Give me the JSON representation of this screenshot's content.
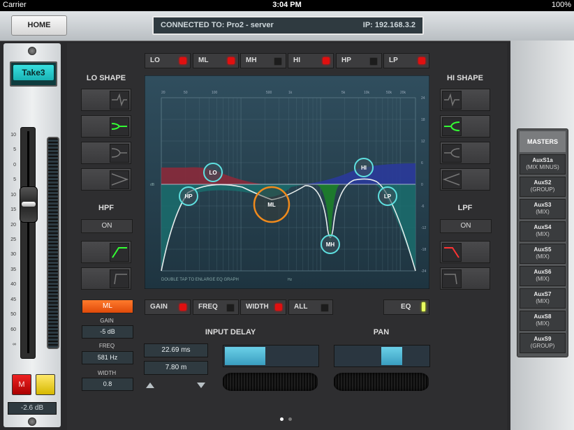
{
  "status_bar": {
    "carrier": "Carrier",
    "time": "3:04 PM",
    "battery": "100%"
  },
  "topbar": {
    "home_label": "HOME",
    "connected_label": "CONNECTED TO: Pro2 - server",
    "ip_label": "IP: 192.168.3.2"
  },
  "channel": {
    "name": "Take3",
    "mute_label": "M",
    "gain_readout": "-2.6 dB",
    "fader_scale": [
      "10",
      "5",
      "0",
      "5",
      "10",
      "15",
      "20",
      "25",
      "30",
      "35",
      "40",
      "45",
      "50",
      "60",
      "∞"
    ]
  },
  "eq_tabs": [
    {
      "label": "LO",
      "led": "on"
    },
    {
      "label": "ML",
      "led": "on"
    },
    {
      "label": "MH",
      "led": "off"
    },
    {
      "label": "HI",
      "led": "on"
    },
    {
      "label": "HP",
      "led": "off"
    },
    {
      "label": "LP",
      "led": "on"
    }
  ],
  "lo_shape": {
    "title": "LO SHAPE"
  },
  "hi_shape": {
    "title": "HI SHAPE"
  },
  "hpf": {
    "title": "HPF",
    "state": "ON"
  },
  "lpf": {
    "title": "LPF",
    "state": "ON"
  },
  "eq_graph": {
    "hint": "DOUBLE TAP TO ENLARGE EQ GRAPH",
    "unit_db": "dB",
    "unit_hz": "Hz",
    "freq_ticks": [
      "20",
      "50",
      "100",
      "500",
      "1k",
      "5k",
      "10k",
      "50k",
      "20k"
    ],
    "db_ticks": [
      "24",
      "18",
      "12",
      "6",
      "0",
      "-6",
      "-12",
      "-18",
      "-24"
    ],
    "bands": [
      {
        "label": "LO",
        "color": "#c04050"
      },
      {
        "label": "HP",
        "color": "#1ab0b0"
      },
      {
        "label": "ML",
        "color": "#f08a1c"
      },
      {
        "label": "MH",
        "color": "#1ab0b0"
      },
      {
        "label": "HI",
        "color": "#3040c0"
      },
      {
        "label": "LP",
        "color": "#1ab0b0"
      }
    ]
  },
  "param_tabs": [
    {
      "label": "GAIN",
      "led": "on"
    },
    {
      "label": "FREQ",
      "led": "off"
    },
    {
      "label": "WIDTH",
      "led": "on"
    },
    {
      "label": "ALL",
      "led": "off"
    }
  ],
  "eq_button": {
    "label": "EQ"
  },
  "band_params": {
    "selected": "ML",
    "gain_label": "GAIN",
    "gain_value": "-5 dB",
    "freq_label": "FREQ",
    "freq_value": "581 Hz",
    "width_label": "WIDTH",
    "width_value": "0.8"
  },
  "input_delay": {
    "title": "INPUT DELAY",
    "time": "22.69 ms",
    "distance": "7.80 m",
    "slider_fraction": 0.44
  },
  "pan": {
    "title": "PAN",
    "position_fraction": 0.6
  },
  "masters": {
    "title": "MASTERS",
    "items": [
      {
        "name": "AuxS1a",
        "type": "(MIX MINUS)"
      },
      {
        "name": "AuxS2",
        "type": "(GROUP)"
      },
      {
        "name": "AuxS3",
        "type": "(MIX)"
      },
      {
        "name": "AuxS4",
        "type": "(MIX)"
      },
      {
        "name": "AuxS5",
        "type": "(MIX)"
      },
      {
        "name": "AuxS6",
        "type": "(MIX)"
      },
      {
        "name": "AuxS7",
        "type": "(MIX)"
      },
      {
        "name": "AuxS8",
        "type": "(MIX)"
      },
      {
        "name": "AuxS9",
        "type": "(GROUP)"
      }
    ]
  },
  "page_indicator": {
    "pages": 2,
    "current": 1
  }
}
